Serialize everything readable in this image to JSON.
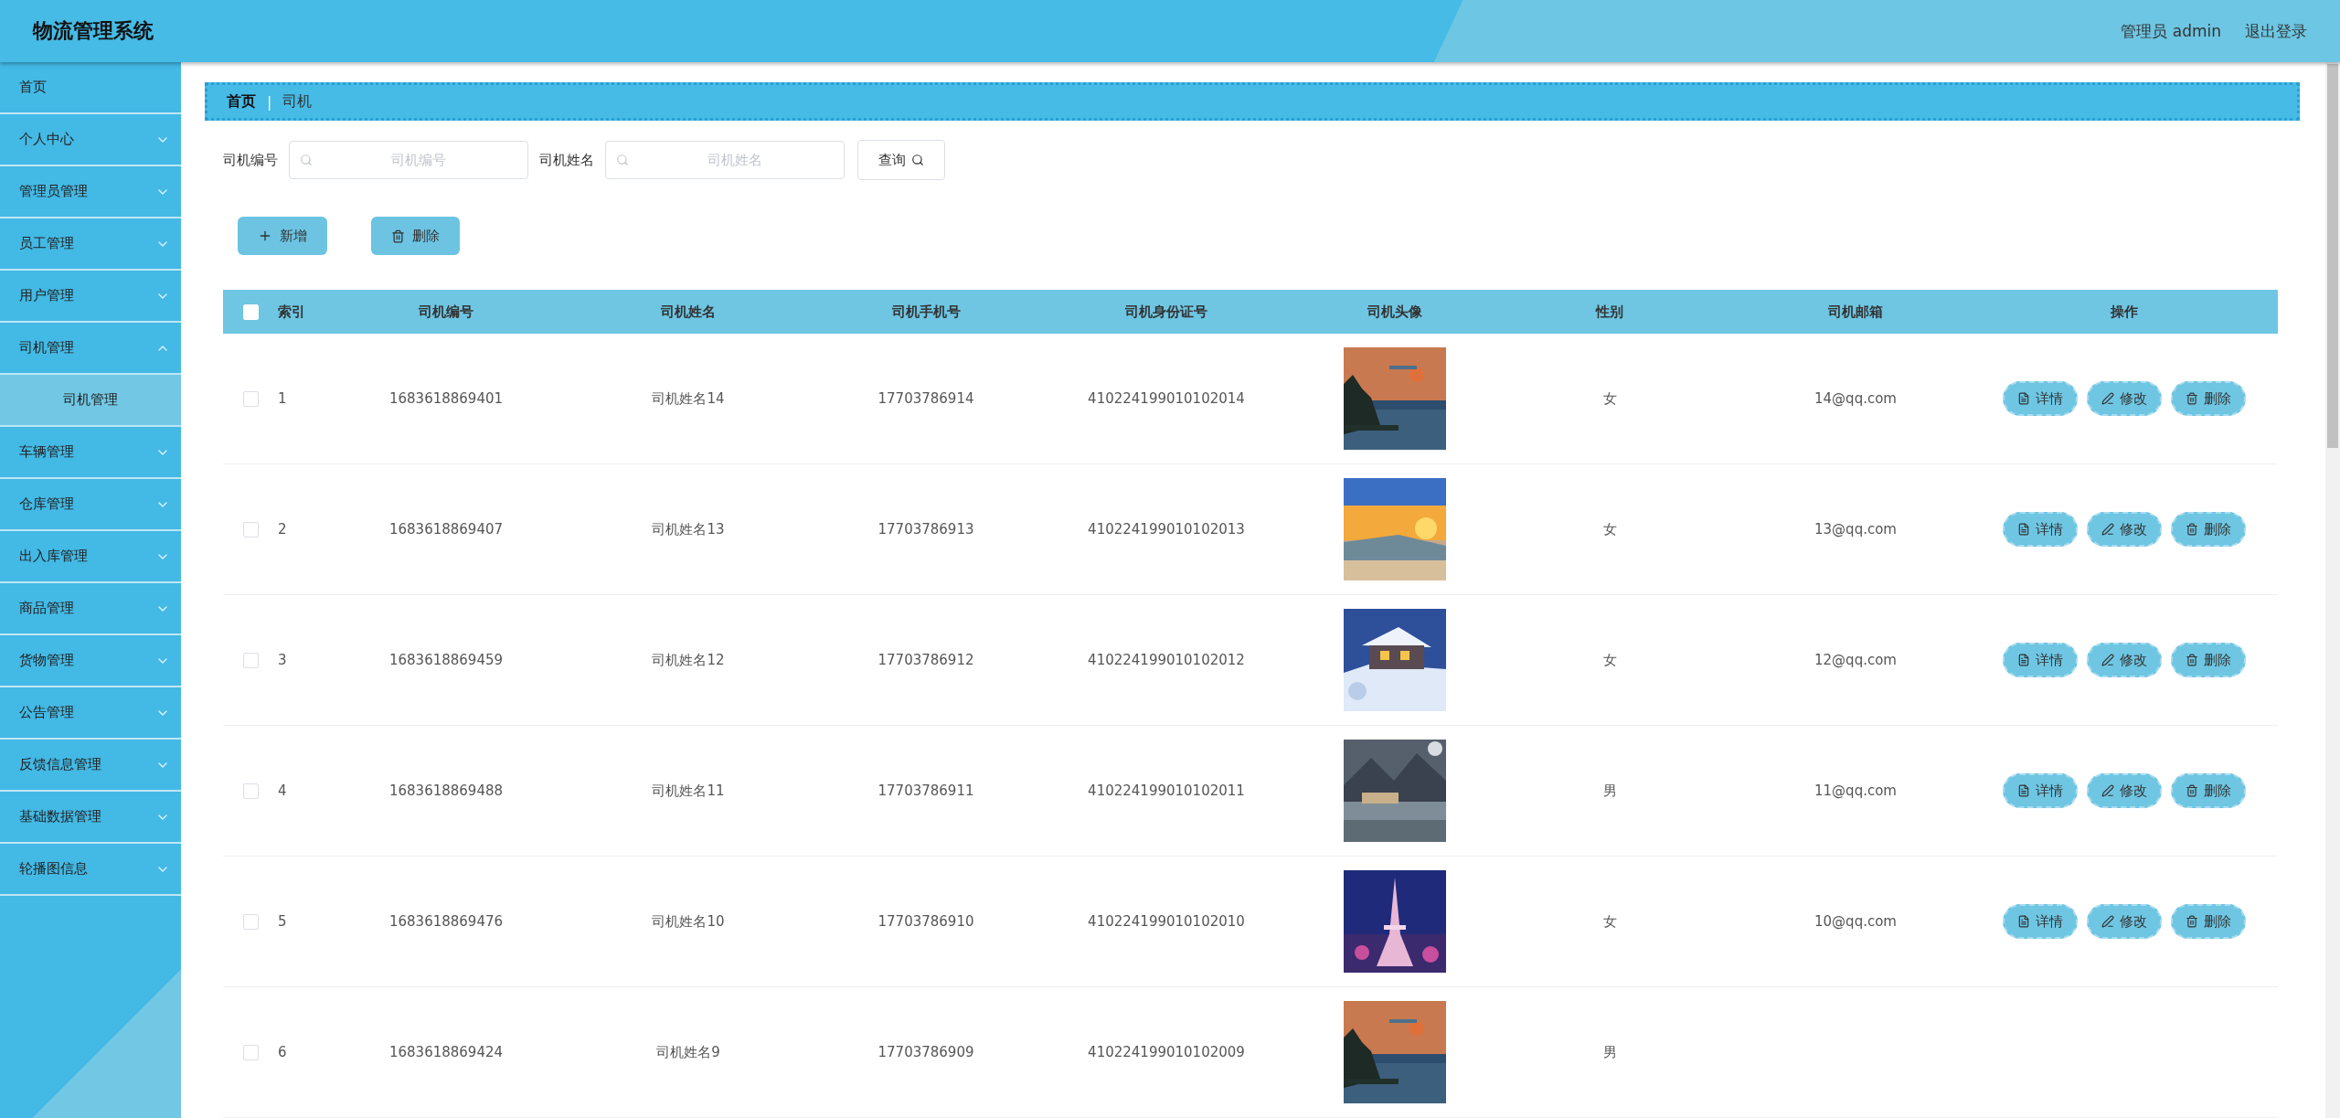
{
  "header": {
    "title": "物流管理系统",
    "user": "管理员 admin",
    "logout": "退出登录"
  },
  "sidebar": {
    "items": [
      {
        "label": "首页",
        "kind": "link"
      },
      {
        "label": "个人中心",
        "kind": "menu",
        "expanded": false
      },
      {
        "label": "管理员管理",
        "kind": "menu",
        "expanded": false
      },
      {
        "label": "员工管理",
        "kind": "menu",
        "expanded": false
      },
      {
        "label": "用户管理",
        "kind": "menu",
        "expanded": false
      },
      {
        "label": "司机管理",
        "kind": "menu",
        "expanded": true,
        "children": [
          {
            "label": "司机管理",
            "selected": true
          }
        ]
      },
      {
        "label": "车辆管理",
        "kind": "menu",
        "expanded": false
      },
      {
        "label": "仓库管理",
        "kind": "menu",
        "expanded": false
      },
      {
        "label": "出入库管理",
        "kind": "menu",
        "expanded": false
      },
      {
        "label": "商品管理",
        "kind": "menu",
        "expanded": false
      },
      {
        "label": "货物管理",
        "kind": "menu",
        "expanded": false
      },
      {
        "label": "公告管理",
        "kind": "menu",
        "expanded": false
      },
      {
        "label": "反馈信息管理",
        "kind": "menu",
        "expanded": false
      },
      {
        "label": "基础数据管理",
        "kind": "menu",
        "expanded": false
      },
      {
        "label": "轮播图信息",
        "kind": "menu",
        "expanded": false
      }
    ]
  },
  "breadcrumb": [
    "首页",
    "|",
    "司机"
  ],
  "search": [
    {
      "label": "司机编号",
      "placeholder": "司机编号"
    },
    {
      "label": "司机姓名",
      "placeholder": "司机姓名"
    }
  ],
  "query_button": "查询",
  "actions": [
    "新增",
    "删除"
  ],
  "table": {
    "select_all_checked": false,
    "columns": [
      "索引",
      "司机编号",
      "司机姓名",
      "司机手机号",
      "司机身份证号",
      "司机头像",
      "性别",
      "司机邮箱",
      "操作"
    ],
    "rows": [
      {
        "checked": false,
        "index": "1",
        "id": "1683618869401",
        "name": "司机姓名14",
        "phone": "17703786914",
        "id_card": "410224199010102014",
        "gender": "女",
        "email": "14@qq.com",
        "operations": [
          "详情",
          "修改",
          "删除"
        ]
      },
      {
        "checked": false,
        "index": "2",
        "id": "1683618869407",
        "name": "司机姓名13",
        "phone": "17703786913",
        "id_card": "410224199010102013",
        "gender": "女",
        "email": "13@qq.com",
        "operations": [
          "详情",
          "修改",
          "删除"
        ]
      },
      {
        "checked": false,
        "index": "3",
        "id": "1683618869459",
        "name": "司机姓名12",
        "phone": "17703786912",
        "id_card": "410224199010102012",
        "gender": "女",
        "email": "12@qq.com",
        "operations": [
          "详情",
          "修改",
          "删除"
        ]
      },
      {
        "checked": false,
        "index": "4",
        "id": "1683618869488",
        "name": "司机姓名11",
        "phone": "17703786911",
        "id_card": "410224199010102011",
        "gender": "男",
        "email": "11@qq.com",
        "operations": [
          "详情",
          "修改",
          "删除"
        ]
      },
      {
        "checked": false,
        "index": "5",
        "id": "1683618869476",
        "name": "司机姓名10",
        "phone": "17703786910",
        "id_card": "410224199010102010",
        "gender": "女",
        "email": "10@qq.com",
        "operations": [
          "详情",
          "修改",
          "删除"
        ]
      },
      {
        "checked": false,
        "index": "6",
        "id": "1683618869424",
        "name": "司机姓名9",
        "phone": "17703786909",
        "id_card": "410224199010102009",
        "gender": "男"
      }
    ]
  }
}
